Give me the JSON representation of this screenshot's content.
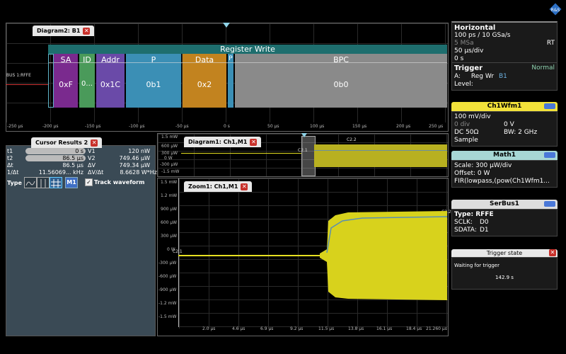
{
  "diagram2": {
    "tab": "Diagram2: B1",
    "banner": "Register Write",
    "bus_label": "BUS 1:RFFE",
    "segments": [
      {
        "head": "SA",
        "val": "0xF"
      },
      {
        "head": "ID",
        "val": "0..."
      },
      {
        "head": "Addr",
        "val": "0x1C"
      },
      {
        "head": "P",
        "val": "0b1"
      },
      {
        "head": "Data",
        "val": "0x2"
      },
      {
        "head": "P",
        "val": ""
      },
      {
        "head": "BPC",
        "val": "0b0"
      }
    ],
    "xticks": [
      "-250 µs",
      "-200 µs",
      "-150 µs",
      "-100 µs",
      "-50 µs",
      "0 s",
      "50 µs",
      "100 µs",
      "150 µs",
      "200 µs",
      "250 µs"
    ]
  },
  "cursor": {
    "tab": "Cursor Results 2",
    "rows": [
      {
        "l1": "t1",
        "v1": "0 s",
        "l2": "V1",
        "v2": "120 nW"
      },
      {
        "l1": "t2",
        "v1": "86.5 µs",
        "l2": "V2",
        "v2": "749.46 µW"
      },
      {
        "l1": "Δt",
        "v1": "86.5 µs",
        "l2": "ΔV",
        "v2": "749.34 µW"
      },
      {
        "l1": "1/Δt",
        "v1": "11.56069... kHz",
        "l2": "ΔV/Δt",
        "v2": "8.6628 W*Hz"
      }
    ],
    "type_label": "Type",
    "m1": "M1",
    "track": "Track waveform"
  },
  "diagram1": {
    "tab": "Diagram1: Ch1,M1",
    "yticks": [
      "1.5 mW",
      "600 µW",
      "300 µW",
      "0 W",
      "-300 µW",
      "-1.5 mW"
    ],
    "c2_label": "C2.2",
    "c1_label": "C2.1"
  },
  "zoom1": {
    "tab": "Zoom1: Ch1,M1",
    "yticks": [
      "1.5 mW",
      "1.2 mW",
      "900 µW",
      "600 µW",
      "300 µW",
      "0 W",
      "-300 µW",
      "-600 µW",
      "-900 µW",
      "-1.2 mW",
      "-1.5 mW"
    ],
    "xticks": [
      "2.0 µs",
      "4.6 µs",
      "6.9 µs",
      "9.2 µs",
      "11.5 µs",
      "13.8 µs",
      "16.1 µs",
      "18.4 µs",
      "21.260 µs"
    ],
    "c1_label": "C2.1",
    "c2_label": "C2.2"
  },
  "horizontal": {
    "title": "Horizontal",
    "line1": "100 ps / 10 GSa/s",
    "line2_left": "5 MSa",
    "line2_right": "RT",
    "line3": "50 µs/div",
    "line4": "0 s"
  },
  "trigger": {
    "title": "Trigger",
    "mode": "Normal",
    "a_label": "A:",
    "a_value": "Reg Wr",
    "a_src": "B1",
    "level": "Level:"
  },
  "ch1": {
    "title": "Ch1Wfm1",
    "r1a": "100 mV/div",
    "r2a": "0 div",
    "r2b": "0 V",
    "r3a": "DC 50Ω",
    "r3b": "BW: 2 GHz",
    "r4a": "Sample"
  },
  "math1": {
    "title": "Math1",
    "r1": "Scale: 300 µW/div",
    "r2": "Offset: 0 W",
    "r3": "FIR(lowpass,(pow(Ch1Wfm1..."
  },
  "serbus": {
    "title": "SerBus1",
    "r1": "Type: RFFE",
    "r2a": "SCLK:",
    "r2b": "D0",
    "r3a": "SDATA:",
    "r3b": "D1"
  },
  "trigstate": {
    "title": "Trigger state",
    "text": "Waiting for trigger",
    "time": "142.9 s"
  },
  "colors": {
    "waveform": "#e6e021",
    "segment_SA": "#7a2a8e",
    "segment_ID": "#4a9a5a",
    "segment_Addr": "#6a4aa8",
    "segment_P": "#3b8fb5",
    "segment_Data": "#c2831f",
    "segment_BPC": "#8a8a8a",
    "banner": "#1e6e6e"
  }
}
